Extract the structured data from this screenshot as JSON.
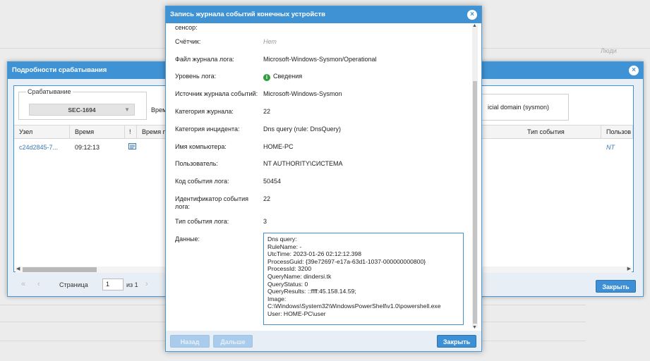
{
  "background": {
    "people_label": "Люди"
  },
  "back_dialog": {
    "title": "Подробности срабатывания",
    "trigger_group_label": "Срабатывание",
    "trigger_value": "SEC-1694",
    "time_label": "Время",
    "domain_text": "icial domain (sysmon)",
    "columns": [
      "Узел",
      "Время",
      "!",
      "Время пе",
      "Тип события",
      "Пользов"
    ],
    "row": {
      "node": "c24d2845-7...",
      "time": "09:12:13",
      "event_type": "",
      "user": "NT AUTH"
    },
    "pager": {
      "page_label": "Страница",
      "page_value": "1",
      "of_label": "из 1"
    },
    "close_button": "Закрыть"
  },
  "front_dialog": {
    "title": "Запись журнала событий конечных устройств",
    "top_fragment": "сенсор:",
    "fields": {
      "counter": {
        "label": "Счётчик:",
        "value": "Нет"
      },
      "log_file": {
        "label": "Файл журнала лога:",
        "value": "Microsoft-Windows-Sysmon/Operational"
      },
      "log_level": {
        "label": "Уровень лога:",
        "value": "Сведения"
      },
      "source": {
        "label": "Источник журнала событий:",
        "value": "Microsoft-Windows-Sysmon"
      },
      "journal_category": {
        "label": "Категория журнала:",
        "value": "22"
      },
      "incident_category": {
        "label": "Категория инцидента:",
        "value": "Dns query (rule: DnsQuery)"
      },
      "computer": {
        "label": "Имя компьютера:",
        "value": "HOME-PC"
      },
      "user": {
        "label": "Пользователь:",
        "value": "NT AUTHORITY\\СИСТЕМА"
      },
      "event_code": {
        "label": "Код события лога:",
        "value": "50454"
      },
      "event_id": {
        "label": "Идентификатор события лога:",
        "value": "22"
      },
      "event_type": {
        "label": "Тип события лога:",
        "value": "3"
      },
      "data": {
        "label": "Данные:"
      }
    },
    "data_text": "Dns query:\nRuleName: -\nUtcTime: 2023-01-26 02:12:12.398\nProcessGuid: {39e72697-e17a-63d1-1037-000000000800}\nProcessId: 3200\nQueryName: dindersi.tk\nQueryStatus: 0\nQueryResults: ::ffff:45.158.14.59;\nImage:\nC:\\Windows\\System32\\WindowsPowerShell\\v1.0\\powershell.exe\nUser: HOME-PC\\user",
    "back_button": "Назад",
    "next_button": "Дальше",
    "close_button": "Закрыть"
  }
}
